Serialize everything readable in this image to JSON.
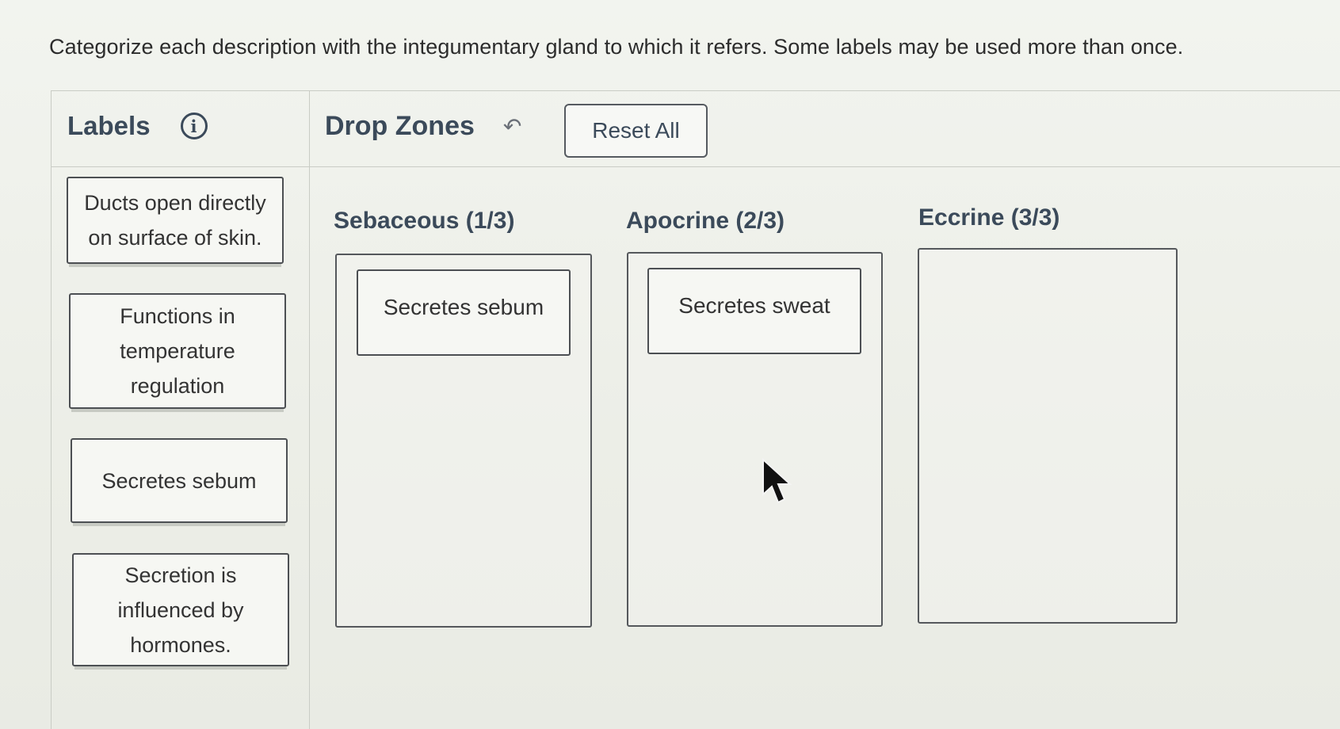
{
  "instructions": "Categorize each description with the integumentary gland to which it refers. Some labels may be used more than once.",
  "labels_panel": {
    "title": "Labels",
    "info_icon": "i",
    "items": [
      {
        "text": "Ducts open directly\non surface of skin."
      },
      {
        "text": "Functions in\ntemperature\nregulation"
      },
      {
        "text": "Secretes sebum"
      },
      {
        "text": "Secretion is\ninfluenced by\nhormones."
      }
    ]
  },
  "drop_panel": {
    "title": "Drop Zones",
    "undo_icon": "↶",
    "reset_label": "Reset All",
    "zones": [
      {
        "title": "Sebaceous (1/3)",
        "placed": [
          "Secretes sebum"
        ]
      },
      {
        "title": "Apocrine (2/3)",
        "placed": [
          "Secretes sweat"
        ]
      },
      {
        "title": "Eccrine (3/3)",
        "placed": []
      }
    ]
  },
  "icons": {
    "info": "info-circle-icon",
    "undo": "undo-arrow-icon",
    "cursor": "mouse-pointer-icon"
  },
  "colors": {
    "heading": "#3b4a5a",
    "border": "#4c4f53",
    "background": "#eef1ea"
  }
}
